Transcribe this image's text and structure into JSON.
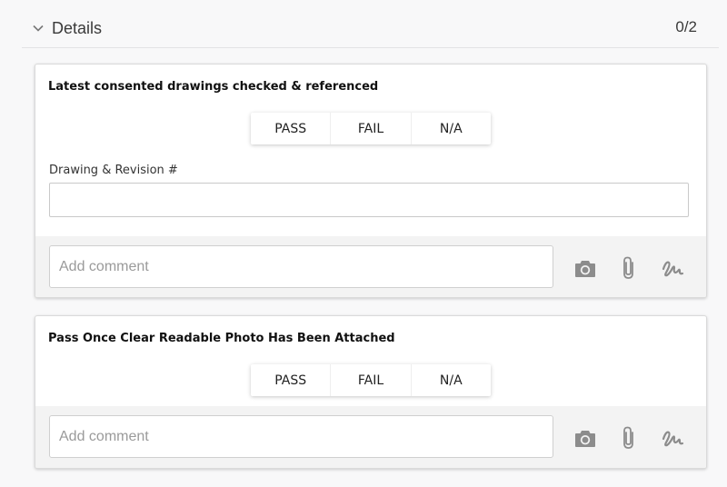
{
  "section": {
    "title": "Details",
    "count": "0/2"
  },
  "items": [
    {
      "title": "Latest consented drawings checked & referenced",
      "options": [
        "PASS",
        "FAIL",
        "N/A"
      ],
      "field": {
        "label": "Drawing & Revision #",
        "value": ""
      },
      "comment": {
        "placeholder": "Add comment"
      },
      "tools": [
        "camera-icon",
        "paperclip-icon",
        "signature-icon"
      ]
    },
    {
      "title": "Pass Once Clear Readable Photo Has Been Attached",
      "options": [
        "PASS",
        "FAIL",
        "N/A"
      ],
      "comment": {
        "placeholder": "Add comment"
      },
      "tools": [
        "camera-icon",
        "paperclip-icon",
        "signature-icon"
      ]
    }
  ],
  "colors": {
    "background": "#f8f8f9",
    "card": "#ffffff",
    "footer": "#f3f3f3",
    "icon": "#8c8c8c"
  }
}
